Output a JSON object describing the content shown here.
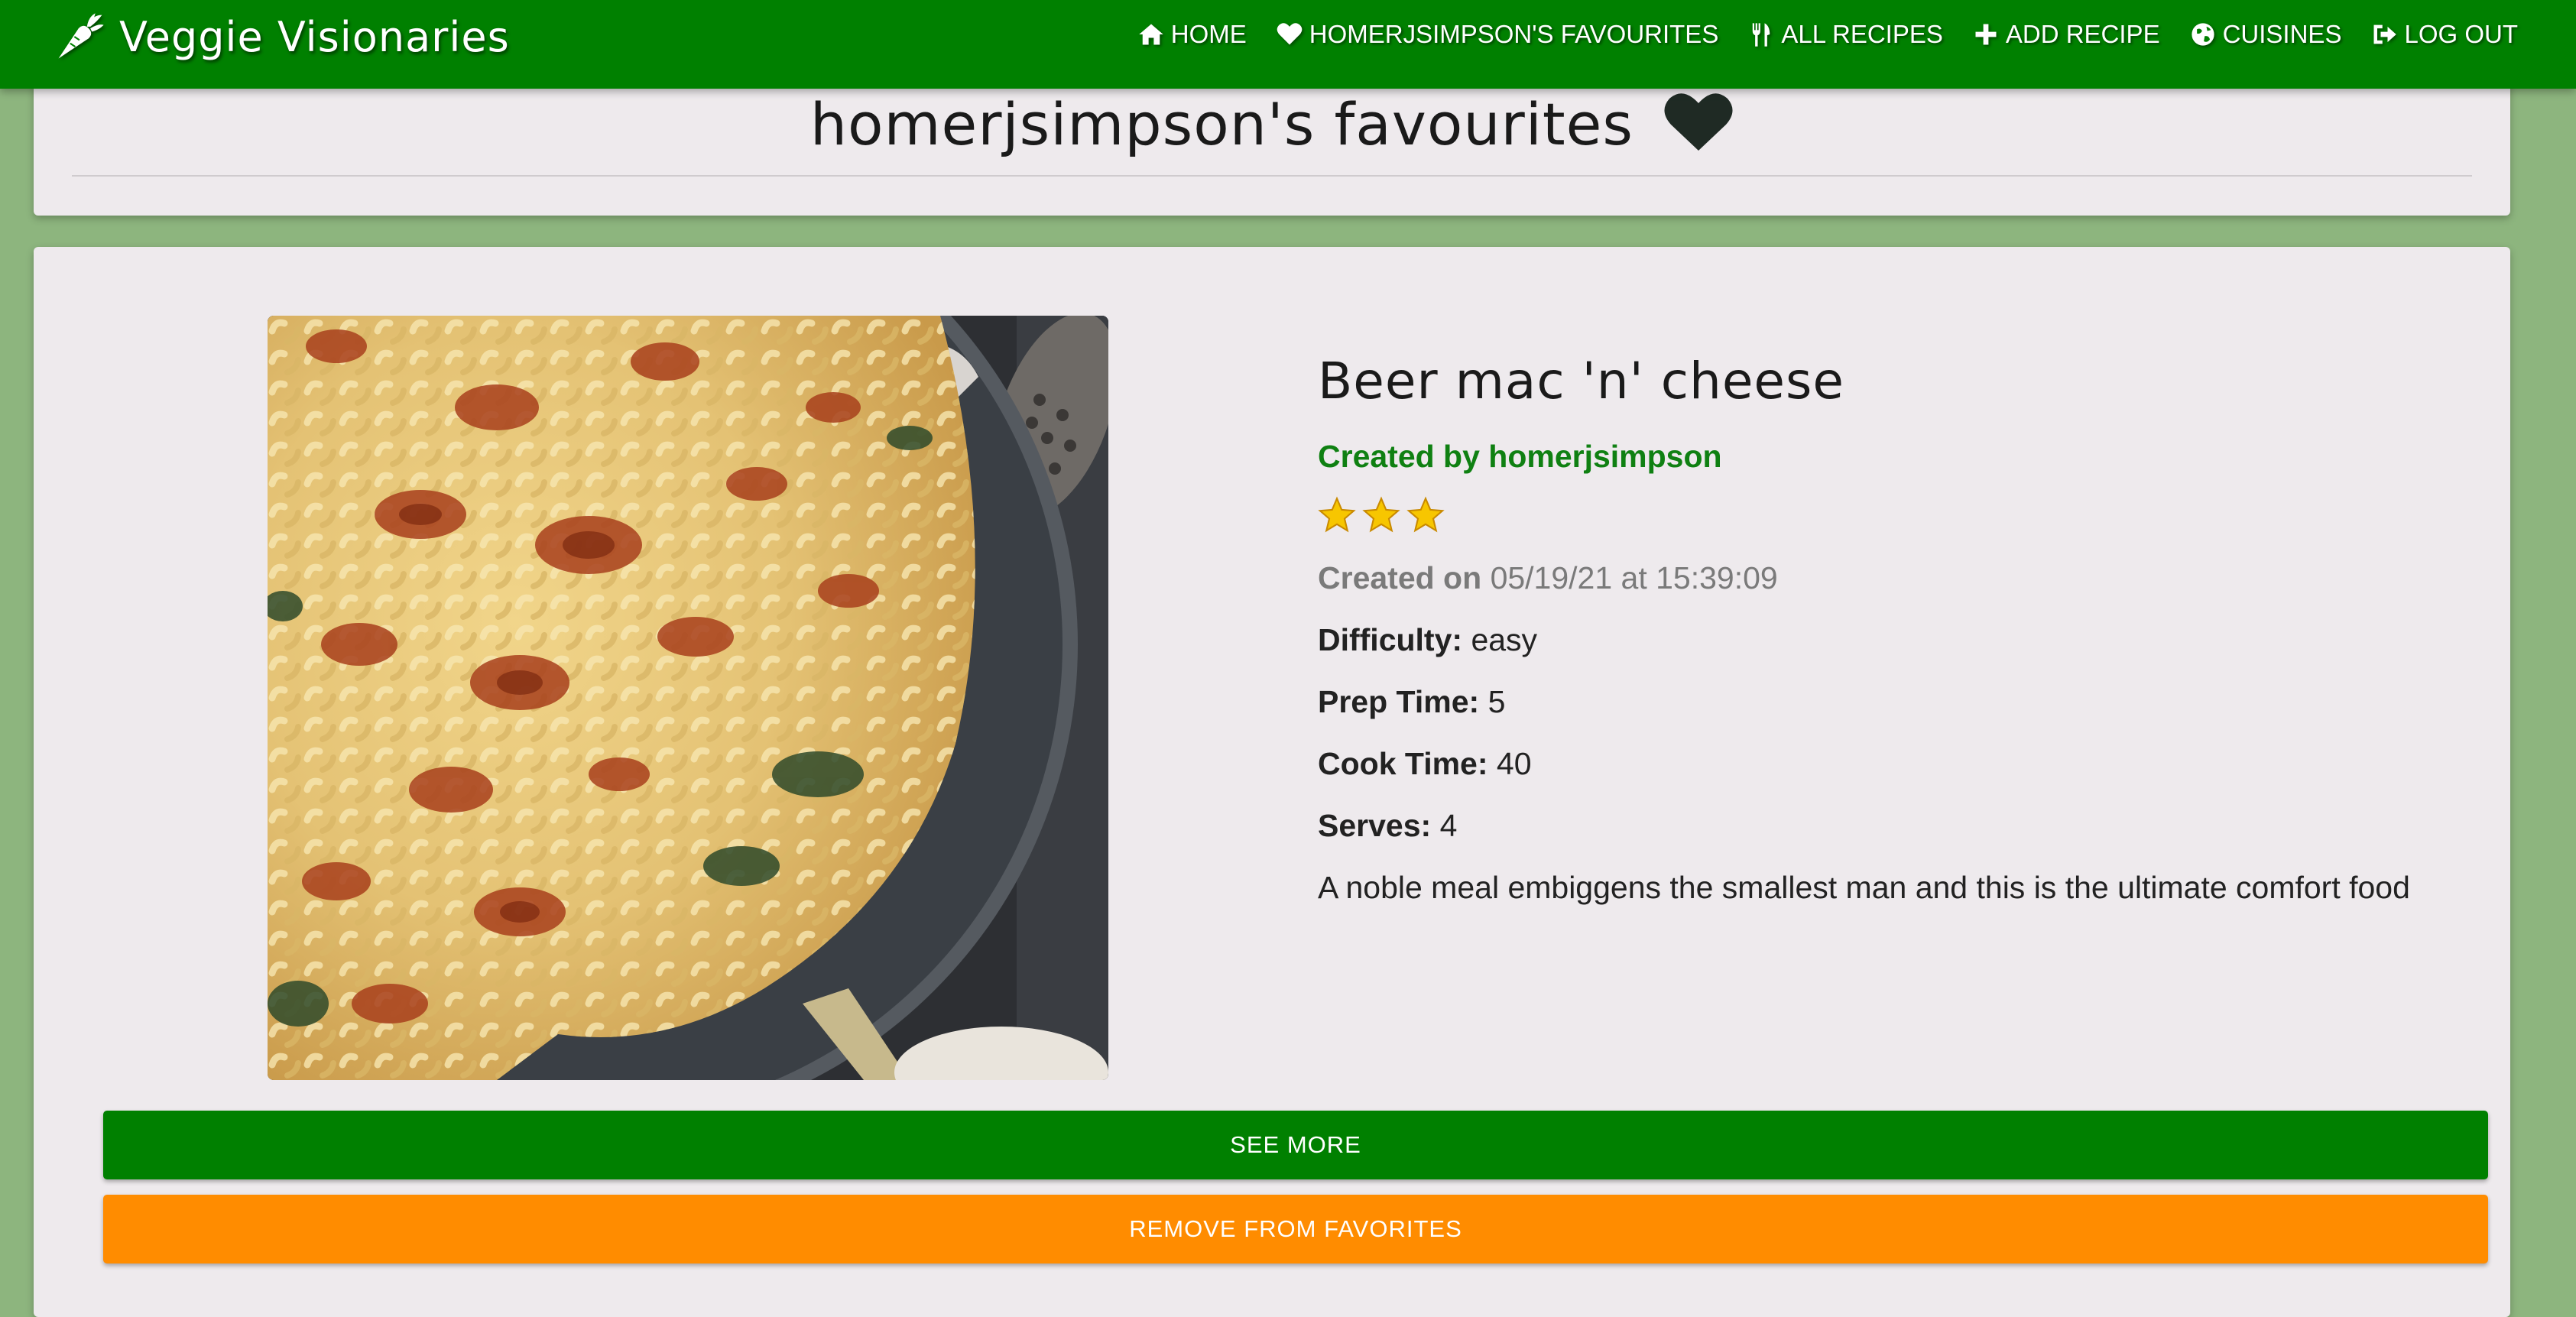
{
  "app": {
    "brand_name": "Veggie Visionaries",
    "brand_icon": "carrot-icon"
  },
  "nav": {
    "items": [
      {
        "label": "HOME",
        "icon": "home-icon"
      },
      {
        "label": "HOMERJSIMPSON'S FAVOURITES",
        "icon": "heart-icon"
      },
      {
        "label": "ALL RECIPES",
        "icon": "utensils-icon"
      },
      {
        "label": "ADD RECIPE",
        "icon": "plus-icon"
      },
      {
        "label": "CUISINES",
        "icon": "globe-icon"
      },
      {
        "label": "LOG OUT",
        "icon": "sign-out-icon"
      }
    ]
  },
  "page": {
    "title": "homerjsimpson's favourites",
    "title_icon": "heart-icon"
  },
  "recipe": {
    "title": "Beer mac 'n' cheese",
    "author": "Created by homerjsimpson",
    "rating": 3,
    "created_label": "Created on",
    "created_value": "05/19/21 at 15:39:09",
    "difficulty_label": "Difficulty:",
    "difficulty_value": "easy",
    "prep_label": "Prep Time:",
    "prep_value": "5",
    "cook_label": "Cook Time:",
    "cook_value": "40",
    "serves_label": "Serves:",
    "serves_value": "4",
    "description": "A noble meal embiggens the smallest man and this is the ultimate comfort food",
    "image_subject": "baked macaroni and cheese in a pan"
  },
  "actions": {
    "see_more_label": "SEE MORE",
    "remove_label": "REMOVE FROM FAVORITES"
  },
  "colors": {
    "navbar": "#008000",
    "page_bg": "#8db57e",
    "card_bg": "#eeeaed",
    "author": "#0f8012",
    "see_more_button": "#008000",
    "remove_button": "#ff8c00",
    "star": "#f7c600"
  }
}
